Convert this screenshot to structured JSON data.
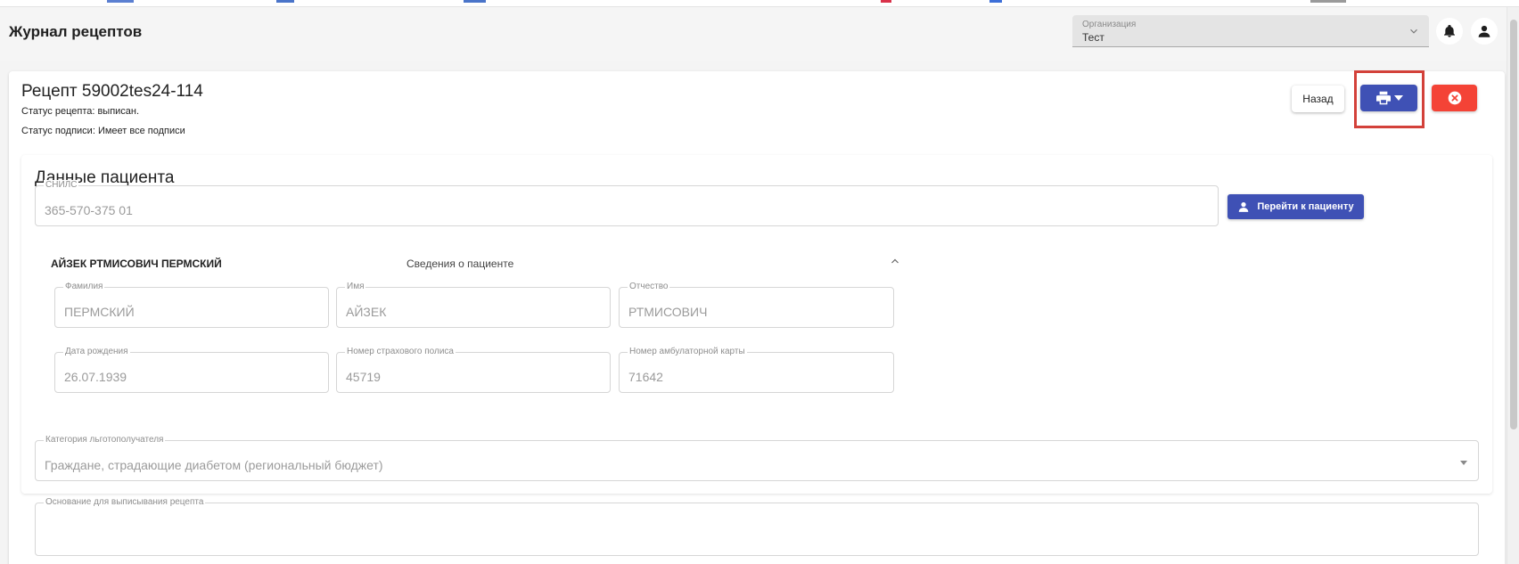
{
  "header": {
    "title": "Журнал рецептов",
    "organization": {
      "label": "Организация",
      "value": "Тест"
    },
    "icons": {
      "notifications": "bell-icon",
      "account": "user-icon",
      "dropdown": "chevron-down-icon"
    }
  },
  "recipe": {
    "title": "Рецепт 59002tes24-114",
    "status": "Статус рецепта: выписан.",
    "signature_status": "Статус подписи: Имеет все подписи"
  },
  "actions": {
    "back_label": "Назад",
    "print_icon": "printer-icon",
    "cancel_icon": "close-circle-icon"
  },
  "patient": {
    "section_title": "Данные пациента",
    "snils": {
      "label": "СНИЛС",
      "value": "365-570-375 01"
    },
    "goto_label": "Перейти к пациенту",
    "full_name": "АЙЗЕК РТМИСОВИЧ ПЕРМСКИЙ",
    "info_label": "Сведения о пациенте",
    "fields": {
      "last_name": {
        "label": "Фамилия",
        "value": "ПЕРМСКИЙ"
      },
      "first_name": {
        "label": "Имя",
        "value": "АЙЗЕК"
      },
      "patronymic": {
        "label": "Отчество",
        "value": "РТМИСОВИЧ"
      },
      "birth_date": {
        "label": "Дата рождения",
        "value": "26.07.1939"
      },
      "policy_number": {
        "label": "Номер страхового полиса",
        "value": "45719"
      },
      "card_number": {
        "label": "Номер амбулаторной карты",
        "value": "71642"
      }
    }
  },
  "benefit": {
    "label": "Категория льготополучателя",
    "value": "Граждане, страдающие диабетом (региональный бюджет)"
  },
  "basis": {
    "label": "Основание для выписывания рецепта"
  },
  "colors": {
    "primary": "#3f51b5",
    "danger": "#f44336",
    "highlight": "#d3413a"
  }
}
